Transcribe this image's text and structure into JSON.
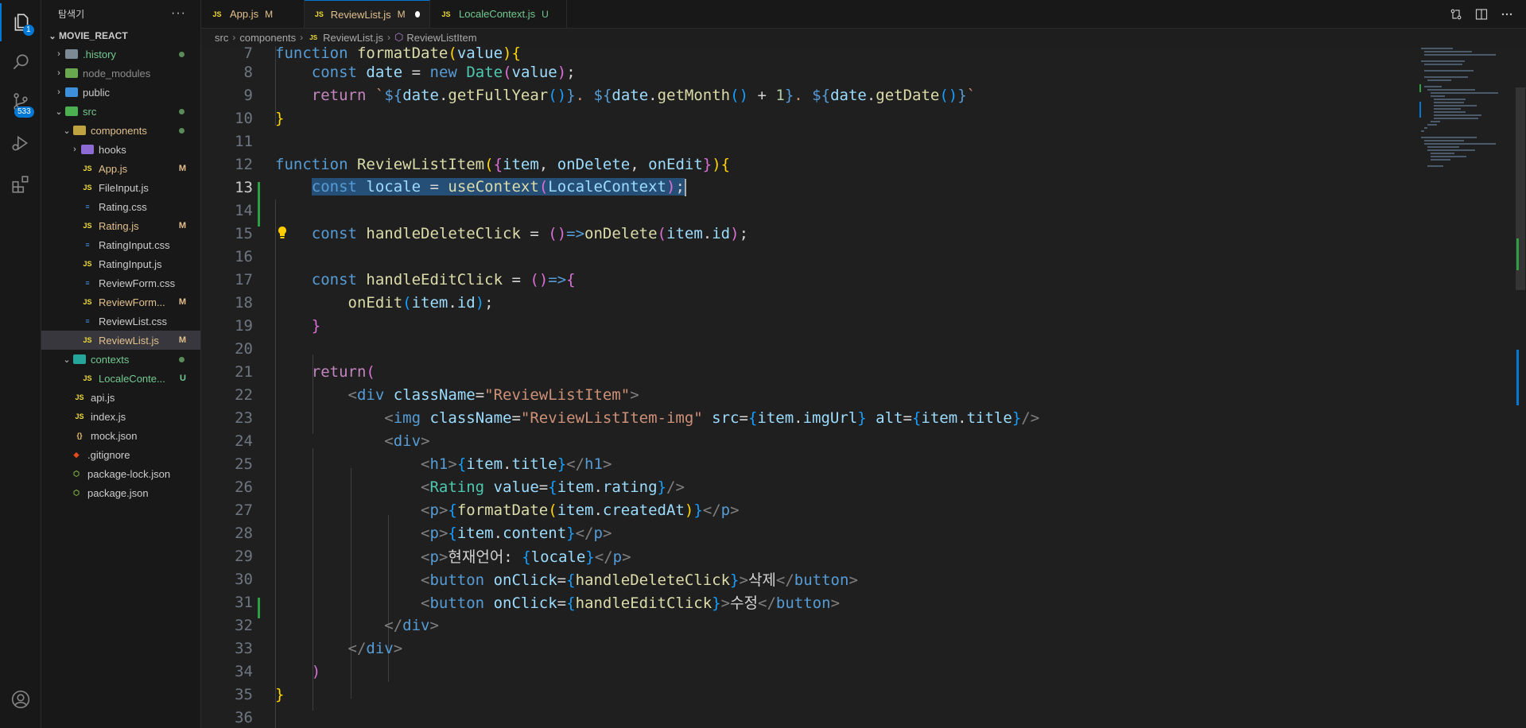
{
  "activity_bar": {
    "explorer_badge": "1",
    "scm_badge": "533"
  },
  "sidebar": {
    "title": "탐색기",
    "more": "···",
    "project": "MOVIE_REACT",
    "tree": [
      {
        "name": ".history",
        "status": "dot"
      },
      {
        "name": "node_modules"
      },
      {
        "name": "public"
      },
      {
        "name": "src",
        "status": "dot"
      },
      {
        "name": "components",
        "status": "dot"
      },
      {
        "name": "hooks"
      },
      {
        "name": "App.js",
        "status": "M"
      },
      {
        "name": "FileInput.js"
      },
      {
        "name": "Rating.css"
      },
      {
        "name": "Rating.js",
        "status": "M"
      },
      {
        "name": "RatingInput.css"
      },
      {
        "name": "RatingInput.js"
      },
      {
        "name": "ReviewForm.css"
      },
      {
        "name": "ReviewForm...",
        "status": "M"
      },
      {
        "name": "ReviewList.css"
      },
      {
        "name": "ReviewList.js",
        "status": "M"
      },
      {
        "name": "contexts",
        "status": "dot"
      },
      {
        "name": "LocaleConte...",
        "status": "U"
      },
      {
        "name": "api.js"
      },
      {
        "name": "index.js"
      },
      {
        "name": "mock.json"
      },
      {
        "name": ".gitignore"
      },
      {
        "name": "package-lock.json"
      },
      {
        "name": "package.json"
      }
    ]
  },
  "tabs": [
    {
      "label": "App.js",
      "state": "M"
    },
    {
      "label": "ReviewList.js",
      "state": "M"
    },
    {
      "label": "LocaleContext.js",
      "state": "U"
    }
  ],
  "breadcrumb": [
    "src",
    "components",
    "ReviewList.js",
    "ReviewListItem"
  ],
  "editor": {
    "current_line": "13",
    "line_numbers": [
      "7",
      "8",
      "9",
      "10",
      "11",
      "12",
      "13",
      "14",
      "15",
      "16",
      "17",
      "18",
      "19",
      "20",
      "21",
      "22",
      "23",
      "24",
      "25",
      "26",
      "27",
      "28",
      "29",
      "30",
      "31",
      "32",
      "33",
      "34",
      "35",
      "36"
    ],
    "texts": {
      "l29_text": "현재언어: ",
      "l30_text": "삭제",
      "l31_text": "수정"
    }
  },
  "colors": {
    "accent": "#0078d4",
    "modified": "#e2c08d",
    "untracked": "#73c991",
    "selection": "#264f78"
  }
}
